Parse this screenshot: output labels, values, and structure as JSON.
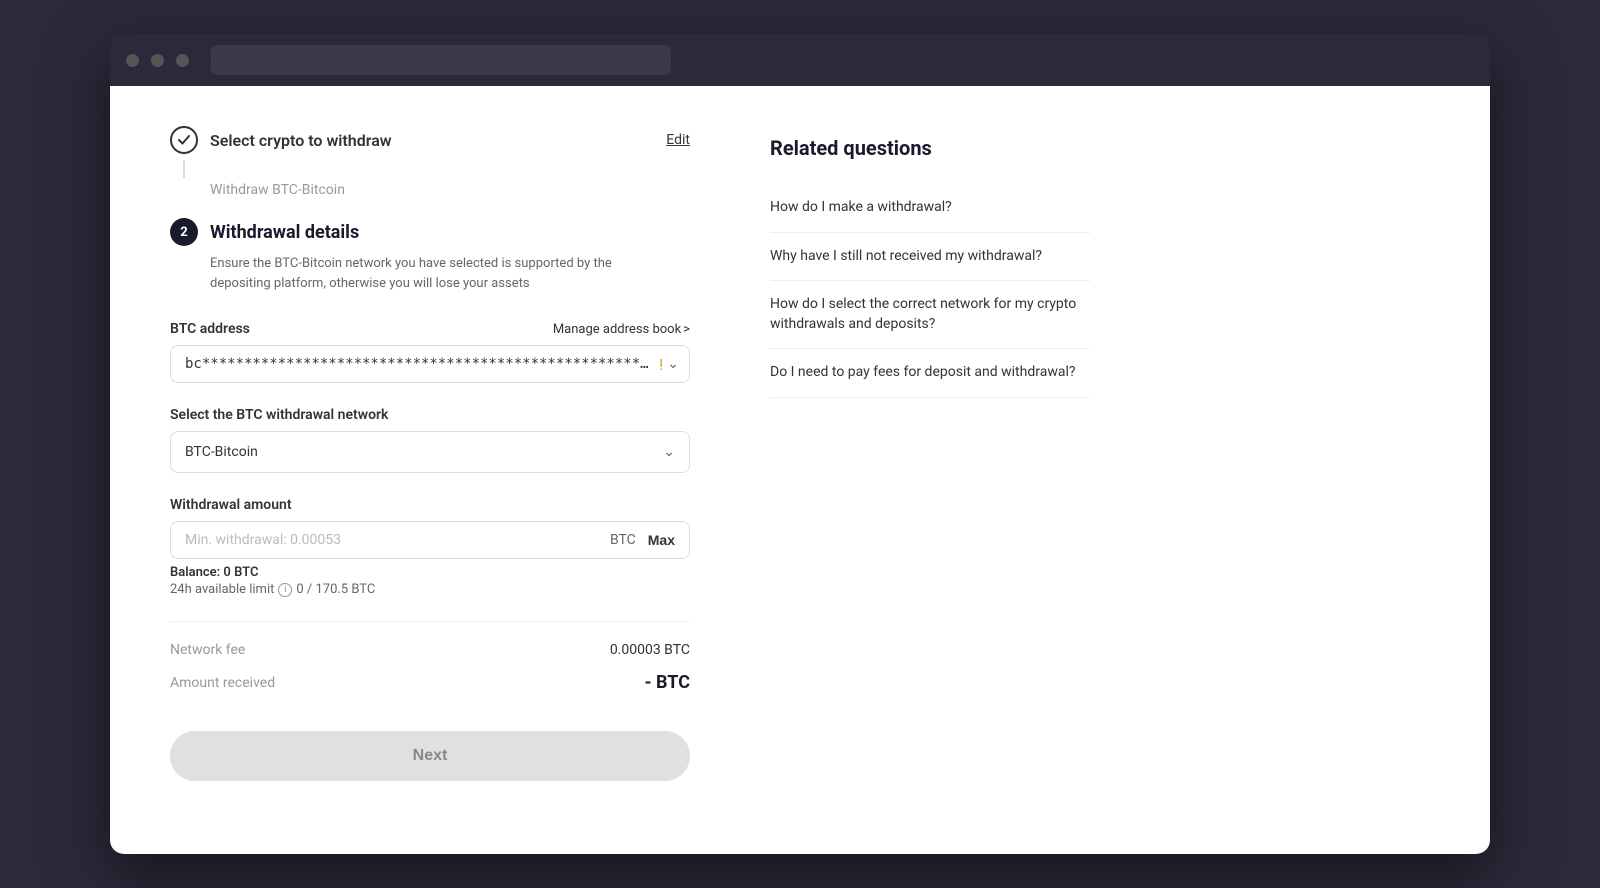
{
  "browser": {
    "dots": [
      "dot1",
      "dot2",
      "dot3"
    ]
  },
  "steps": {
    "step1": {
      "title": "Select crypto to withdraw",
      "edit_label": "Edit",
      "subtitle": "Withdraw BTC-Bitcoin",
      "status": "completed"
    },
    "step2": {
      "number": "2",
      "title": "Withdrawal details",
      "description": "Ensure the BTC-Bitcoin network you have selected is supported by the depositing platform, otherwise you will lose your assets",
      "status": "active"
    }
  },
  "form": {
    "address_label": "BTC address",
    "manage_address_label": "Manage address book",
    "address_value": "bc***********************************************************!",
    "network_label": "Select the BTC withdrawal network",
    "network_value": "BTC-Bitcoin",
    "amount_label": "Withdrawal amount",
    "amount_placeholder": "Min. withdrawal: 0.00053",
    "amount_currency": "BTC",
    "max_label": "Max",
    "balance_label": "Balance:",
    "balance_value": "0 BTC",
    "limit_label": "24h available limit",
    "limit_value": "0 / 170.5 BTC",
    "network_fee_label": "Network fee",
    "network_fee_value": "0.00003 BTC",
    "amount_received_label": "Amount received",
    "amount_received_value": "- BTC"
  },
  "buttons": {
    "next_label": "Next"
  },
  "related_questions": {
    "title": "Related questions",
    "items": [
      "How do I make a withdrawal?",
      "Why have I still not received my withdrawal?",
      "How do I select the correct network for my crypto withdrawals and deposits?",
      "Do I need to pay fees for deposit and withdrawal?"
    ]
  }
}
